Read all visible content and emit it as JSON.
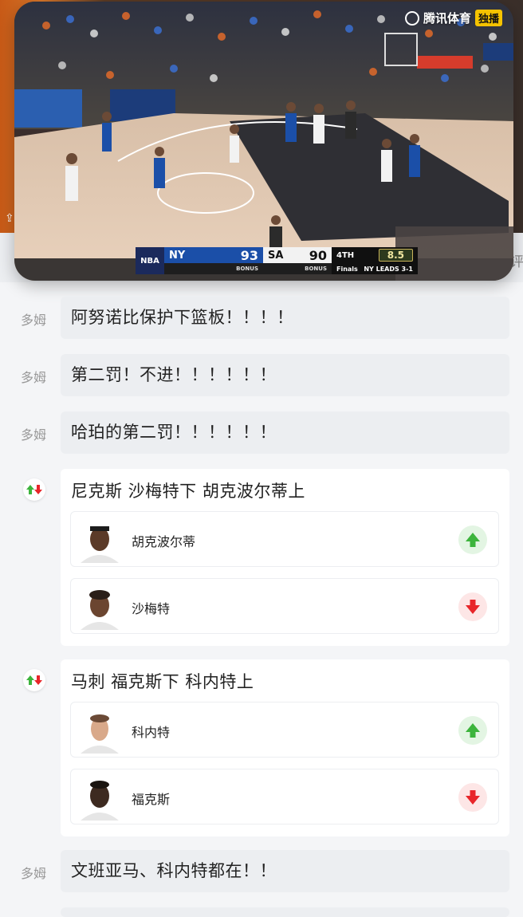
{
  "video": {
    "brand": "腾讯体育",
    "brand_tag": "独播",
    "scoreboard": {
      "league": "NBA",
      "home_team": "NY",
      "home_score": "93",
      "away_team": "SA",
      "away_score": "90",
      "bonus_left": "BONUS",
      "bonus_right": "BONUS",
      "quarter": "4TH",
      "clock": "8.5",
      "series_note": "NY LEADS 3-1",
      "finals": "Finals"
    }
  },
  "edge_text_right": "评",
  "feed": [
    {
      "type": "text",
      "author": "多姆",
      "text": "阿努诺比保护下篮板！！！！"
    },
    {
      "type": "text",
      "author": "多姆",
      "text": "第二罚！不进！！！！！！"
    },
    {
      "type": "text",
      "author": "多姆",
      "text": "哈珀的第二罚！！！！！！"
    },
    {
      "type": "substitution",
      "icon": "substitution-icon",
      "title": "尼克斯 沙梅特下 胡克波尔蒂上",
      "players": [
        {
          "name": "胡克波尔蒂",
          "direction": "in"
        },
        {
          "name": "沙梅特",
          "direction": "out"
        }
      ]
    },
    {
      "type": "substitution",
      "icon": "substitution-icon",
      "title": "马刺 福克斯下 科内特上",
      "players": [
        {
          "name": "科内特",
          "direction": "in"
        },
        {
          "name": "福克斯",
          "direction": "out"
        }
      ]
    },
    {
      "type": "text",
      "author": "多姆",
      "text": "文班亚马、科内特都在！！"
    }
  ],
  "colors": {
    "home_team": "#1b4fa8",
    "arrow_up": "#3cb43c",
    "arrow_down": "#e8262a",
    "bubble_bg": "#eceef1",
    "page_bg": "#f4f5f7"
  }
}
